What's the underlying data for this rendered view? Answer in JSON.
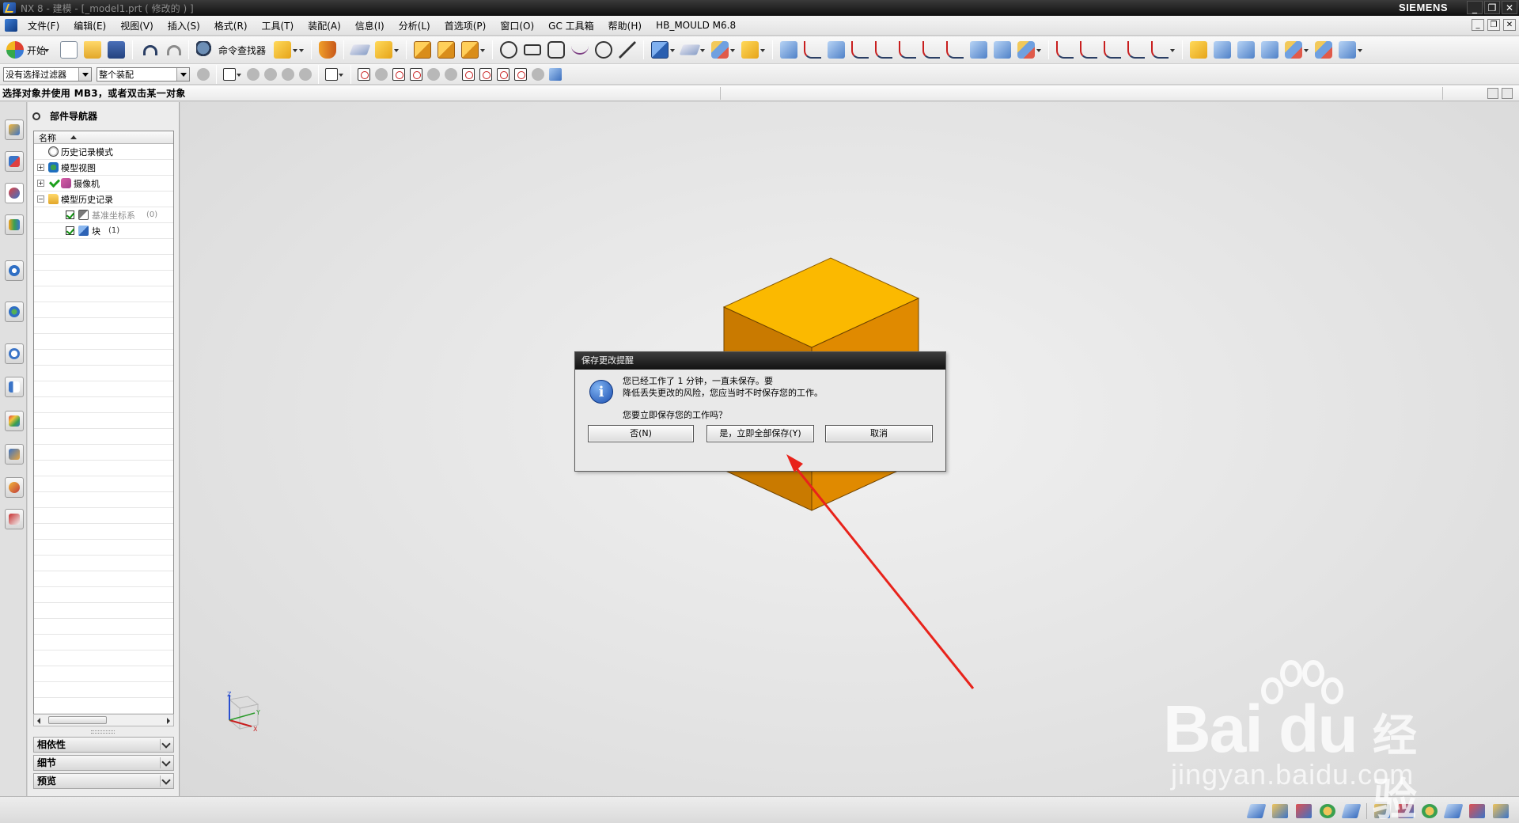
{
  "titlebar": {
    "title": "NX 8 - 建模 - [_model1.prt  ( 修改的 ) ]",
    "brand": "SIEMENS",
    "buttons": [
      "_",
      "❐",
      "✕"
    ]
  },
  "menubar": {
    "items": [
      "文件(F)",
      "编辑(E)",
      "视图(V)",
      "插入(S)",
      "格式(R)",
      "工具(T)",
      "装配(A)",
      "信息(I)",
      "分析(L)",
      "首选项(P)",
      "窗口(O)",
      "GC 工具箱",
      "帮助(H)",
      "HB_MOULD M6.8"
    ]
  },
  "toolbar": {
    "start_label": "开始",
    "command_finder_label": "命令查找器"
  },
  "selection_bar": {
    "filter_value": "没有选择过滤器",
    "scope_value": "整个装配"
  },
  "prompt": {
    "text": "选择对象并使用 MB3，或者双击某一对象"
  },
  "navigator": {
    "title": "部件导航器",
    "column_name": "名称",
    "rows": [
      {
        "label": "历史记录模式",
        "suffix": ""
      },
      {
        "label": "模型视图",
        "suffix": ""
      },
      {
        "label": "摄像机",
        "suffix": ""
      },
      {
        "label": "模型历史记录",
        "suffix": ""
      },
      {
        "label": "基准坐标系",
        "suffix": "(0)"
      },
      {
        "label": "块",
        "suffix": "(1)"
      }
    ],
    "sections": [
      "相依性",
      "细节",
      "预览"
    ]
  },
  "dialog": {
    "title": "保存更改提醒",
    "line1": "您已经工作了 1 分钟，一直未保存。要",
    "line2": "降低丢失更改的风险，您应当时不时保存您的工作。",
    "line3": "您要立即保存您的工作吗？",
    "no_label": "否(N)",
    "yes_label": "是，立即全部保存(Y)",
    "cancel_label": "取消"
  },
  "colors": {
    "block_top": "#FBB900",
    "block_front": "#E08A00",
    "block_side": "#C97A00",
    "arrow": "#E8231B"
  },
  "watermark": {
    "brand": "Bai du",
    "chinese": "经验",
    "url": "jingyan.baidu.com"
  }
}
